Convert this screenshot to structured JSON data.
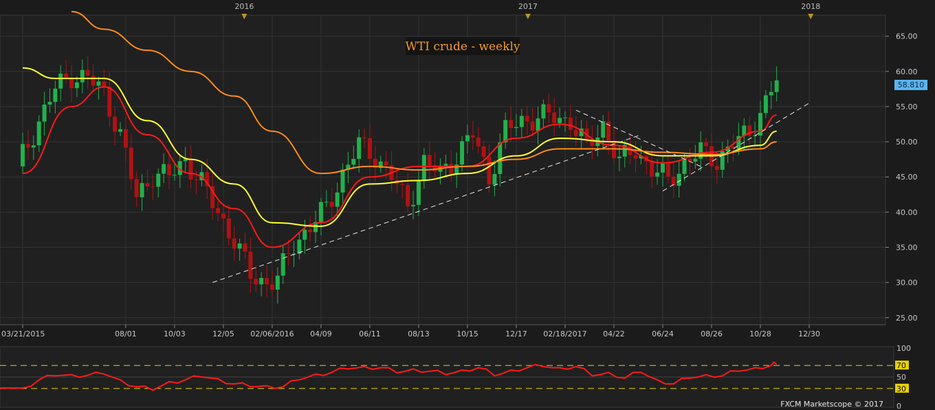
{
  "colors": {
    "background": "#1b1b1b",
    "panel": "#202020",
    "grid": "#333333",
    "up_candle": "#22b14c",
    "down_candle": "#b01212",
    "ema_red": "#ff1a1a",
    "ema_yellow": "#ffff33",
    "ema_orange": "#ff8c1a",
    "trendline": "#e8e8e8",
    "price_badge": "#5ab4f0",
    "rsi_line": "#ff1a1a",
    "rsi_level": "#e6d200"
  },
  "chart_data": {
    "type": "candlestick",
    "title": "WTI crude - weekly",
    "credit": "FXCM Marketscope © 2017",
    "last_price_label": "58.810",
    "y_range": [
      24,
      68
    ],
    "y_ticks": [
      {
        "value": 65,
        "label": "65.00"
      },
      {
        "value": 60,
        "label": "60.00"
      },
      {
        "value": 55,
        "label": "55.00"
      },
      {
        "value": 50,
        "label": "50.00"
      },
      {
        "value": 45,
        "label": "45.00"
      },
      {
        "value": 40,
        "label": "40.00"
      },
      {
        "value": 35,
        "label": "35.00"
      },
      {
        "value": 30,
        "label": "30.00"
      },
      {
        "value": 25,
        "label": "25.00"
      }
    ],
    "x_ticks": [
      {
        "date": "2015-03-21",
        "label": "03/21/2015"
      },
      {
        "date": "2015-08-01",
        "label": "08/01"
      },
      {
        "date": "2015-10-03",
        "label": "10/03"
      },
      {
        "date": "2015-12-05",
        "label": "12/05"
      },
      {
        "date": "2016-02-06",
        "label": "02/06/2016"
      },
      {
        "date": "2016-04-09",
        "label": "04/09"
      },
      {
        "date": "2016-06-11",
        "label": "06/11"
      },
      {
        "date": "2016-08-13",
        "label": "08/13"
      },
      {
        "date": "2016-10-15",
        "label": "10/15"
      },
      {
        "date": "2016-12-17",
        "label": "12/17"
      },
      {
        "date": "2017-02-18",
        "label": "02/18/2017"
      },
      {
        "date": "2017-04-22",
        "label": "04/22"
      },
      {
        "date": "2017-06-24",
        "label": "06/24"
      },
      {
        "date": "2017-08-26",
        "label": "08/26"
      },
      {
        "date": "2017-10-28",
        "label": "10/28"
      },
      {
        "date": "2017-12-30",
        "label": "12/30"
      }
    ],
    "year_markers": [
      {
        "date": "2016-01-01",
        "label": "2016"
      },
      {
        "date": "2017-01-01",
        "label": "2017"
      },
      {
        "date": "2018-01-01",
        "label": "2018"
      }
    ],
    "close_series": {
      "dates": [
        "2015-03-21",
        "2015-04-11",
        "2015-05-02",
        "2015-05-23",
        "2015-06-13",
        "2015-07-04",
        "2015-07-25",
        "2015-08-15",
        "2015-09-05",
        "2015-09-26",
        "2015-10-17",
        "2015-11-07",
        "2015-11-28",
        "2015-12-19",
        "2016-01-09",
        "2016-01-30",
        "2016-02-13",
        "2016-03-05",
        "2016-03-26",
        "2016-04-16",
        "2016-05-07",
        "2016-05-28",
        "2016-06-18",
        "2016-07-09",
        "2016-07-30",
        "2016-08-20",
        "2016-09-10",
        "2016-10-01",
        "2016-10-22",
        "2016-11-12",
        "2016-12-03",
        "2016-12-24",
        "2017-01-14",
        "2017-02-04",
        "2017-02-25",
        "2017-03-18",
        "2017-04-08",
        "2017-04-29",
        "2017-05-20",
        "2017-06-10",
        "2017-07-01",
        "2017-07-22",
        "2017-08-12",
        "2017-09-02",
        "2017-09-23",
        "2017-10-14",
        "2017-11-04",
        "2017-11-18"
      ],
      "values": [
        48.0,
        53.0,
        57.5,
        59.5,
        59.0,
        57.0,
        51.0,
        42.0,
        45.5,
        45.0,
        47.5,
        44.0,
        40.0,
        36.0,
        31.0,
        30.0,
        30.5,
        35.5,
        38.0,
        40.5,
        45.5,
        49.5,
        48.0,
        45.0,
        41.0,
        47.0,
        45.5,
        48.0,
        51.0,
        45.0,
        51.5,
        53.0,
        53.5,
        53.5,
        53.0,
        49.0,
        52.5,
        47.0,
        49.0,
        46.0,
        44.5,
        47.0,
        48.5,
        47.5,
        49.5,
        51.5,
        55.5,
        58.8
      ]
    },
    "series": [
      {
        "name": "EMA fast",
        "color": "#ff1a1a",
        "dates": [
          "2015-03-21",
          "2015-05-23",
          "2015-07-04",
          "2015-08-29",
          "2015-10-24",
          "2015-12-19",
          "2016-02-06",
          "2016-04-09",
          "2016-06-11",
          "2016-08-13",
          "2016-10-15",
          "2016-12-17",
          "2017-02-11",
          "2017-04-22",
          "2017-06-24",
          "2017-08-26",
          "2017-10-28",
          "2017-11-18"
        ],
        "values": [
          45.5,
          55.0,
          57.8,
          51.0,
          45.5,
          40.5,
          35.0,
          38.5,
          45.0,
          46.5,
          46.5,
          50.5,
          52.5,
          49.5,
          47.0,
          48.5,
          51.5,
          53.8
        ]
      },
      {
        "name": "EMA mid",
        "color": "#ffff33",
        "dates": [
          "2015-03-21",
          "2015-05-02",
          "2015-07-04",
          "2015-08-29",
          "2015-10-24",
          "2015-12-19",
          "2016-02-06",
          "2016-04-09",
          "2016-06-11",
          "2016-08-13",
          "2016-10-15",
          "2016-12-17",
          "2017-02-11",
          "2017-04-22",
          "2017-06-24",
          "2017-08-26",
          "2017-10-28",
          "2017-11-18"
        ],
        "values": [
          60.5,
          59.0,
          59.0,
          53.0,
          47.5,
          44.0,
          38.5,
          38.0,
          44.0,
          44.5,
          45.5,
          48.0,
          50.5,
          50.0,
          48.0,
          48.0,
          49.5,
          51.5
        ]
      },
      {
        "name": "EMA slow",
        "color": "#ff8c1a",
        "dates": [
          "2015-05-23",
          "2015-07-04",
          "2015-08-29",
          "2015-10-24",
          "2015-12-19",
          "2016-02-06",
          "2016-04-09",
          "2016-06-11",
          "2016-08-13",
          "2016-10-15",
          "2016-12-17",
          "2017-02-11",
          "2017-04-22",
          "2017-06-24",
          "2017-08-26",
          "2017-10-28",
          "2017-11-18"
        ],
        "values": [
          68.5,
          66.0,
          63.0,
          60.0,
          56.5,
          51.5,
          45.5,
          46.5,
          46.0,
          46.5,
          47.5,
          49.0,
          49.0,
          48.5,
          48.2,
          49.0,
          50.0
        ]
      }
    ],
    "rsi": {
      "range": [
        0,
        100
      ],
      "levels": [
        30,
        70
      ],
      "tick_labels": [
        "100",
        "70",
        "50",
        "30",
        "0"
      ],
      "dates": [
        "2015-03-21",
        "2015-04-11",
        "2015-05-02",
        "2015-05-23",
        "2015-06-13",
        "2015-07-04",
        "2015-07-25",
        "2015-08-15",
        "2015-09-05",
        "2015-09-26",
        "2015-10-17",
        "2015-11-07",
        "2015-11-28",
        "2015-12-19",
        "2016-01-09",
        "2016-01-30",
        "2016-02-20",
        "2016-03-12",
        "2016-04-02",
        "2016-04-23",
        "2016-05-14",
        "2016-06-04",
        "2016-06-25",
        "2016-07-16",
        "2016-08-06",
        "2016-08-27",
        "2016-09-17",
        "2016-10-08",
        "2016-10-29",
        "2016-11-19",
        "2016-12-10",
        "2016-12-31",
        "2017-01-21",
        "2017-02-11",
        "2017-03-04",
        "2017-03-25",
        "2017-04-15",
        "2017-05-06",
        "2017-05-27",
        "2017-06-17",
        "2017-07-08",
        "2017-07-29",
        "2017-08-19",
        "2017-09-09",
        "2017-09-30",
        "2017-10-21",
        "2017-11-11",
        "2017-11-18"
      ],
      "values": [
        31,
        45,
        52,
        54,
        53,
        55,
        45,
        33,
        27,
        42,
        45,
        50,
        47,
        38,
        33,
        35,
        33,
        45,
        55,
        58,
        64,
        68,
        66,
        57,
        64,
        60,
        54,
        62,
        66,
        52,
        62,
        66,
        68,
        66,
        68,
        52,
        58,
        48,
        58,
        45,
        38,
        48,
        54,
        52,
        60,
        66,
        70,
        72
      ]
    },
    "trendlines": [
      {
        "from": {
          "date": "2015-11-21",
          "value": 30.0
        },
        "to": {
          "date": "2017-05-27",
          "value": 51.0
        }
      },
      {
        "from": {
          "date": "2017-03-04",
          "value": 54.5
        },
        "to": {
          "date": "2017-08-12",
          "value": 46.5
        }
      },
      {
        "from": {
          "date": "2017-06-24",
          "value": 43.0
        },
        "to": {
          "date": "2017-12-30",
          "value": 55.5
        }
      }
    ]
  }
}
